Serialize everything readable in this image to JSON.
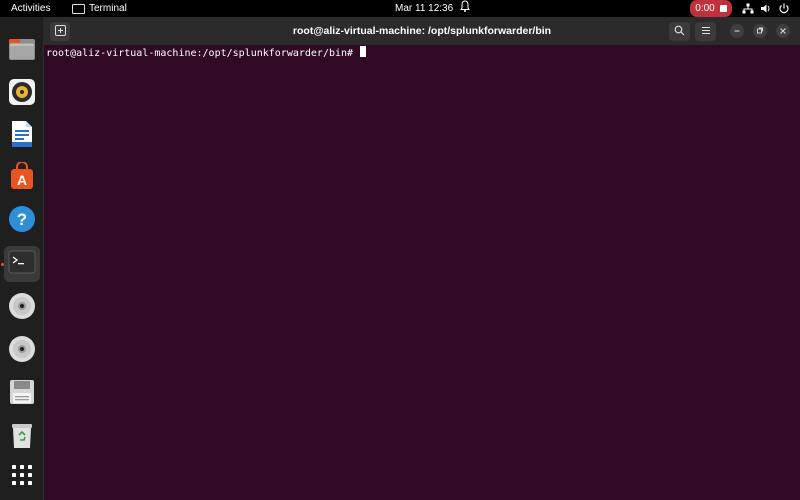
{
  "topbar": {
    "activities": "Activities",
    "app_name": "Terminal",
    "clock": "Mar 11  12:36",
    "recording_time": "0:00"
  },
  "dock": {
    "items": [
      {
        "name": "files"
      },
      {
        "name": "rhythmbox"
      },
      {
        "name": "libreoffice-writer"
      },
      {
        "name": "app-center"
      },
      {
        "name": "help"
      },
      {
        "name": "terminal",
        "active": true
      },
      {
        "name": "dvd-drive-1"
      },
      {
        "name": "dvd-drive-2"
      },
      {
        "name": "floppy-drive"
      },
      {
        "name": "trash"
      },
      {
        "name": "show-apps"
      }
    ]
  },
  "window": {
    "title": "root@aliz-virtual-machine: /opt/splunkforwarder/bin"
  },
  "terminal": {
    "prompt": "root@aliz-virtual-machine:/opt/splunkforwarder/bin# "
  },
  "colors": {
    "terminal_bg": "#300a24",
    "accent": "#e95420",
    "record": "#c0313c"
  }
}
